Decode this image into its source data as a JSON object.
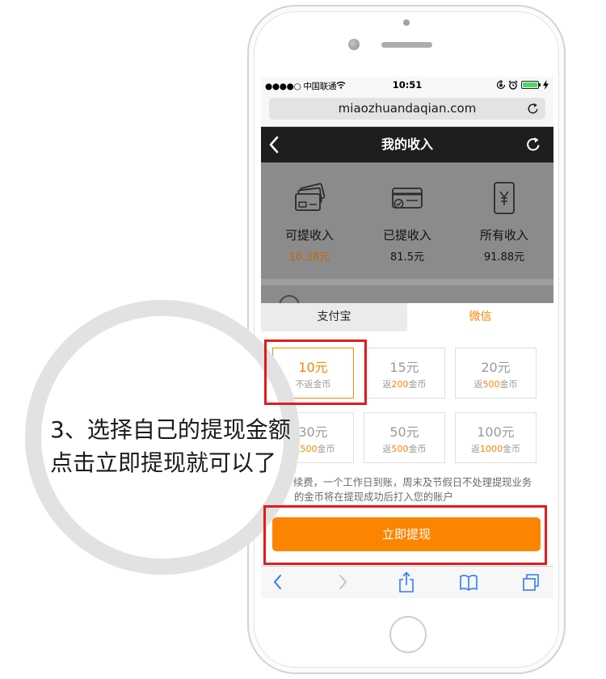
{
  "callout": {
    "line1": "3、选择自己的提现金额",
    "line2": "点击立即提现就可以了"
  },
  "status_bar": {
    "carrier": "●●●●○ 中国联通",
    "time": "10:51",
    "icons": [
      "wifi-icon",
      "orientation-lock-icon",
      "alarm-icon",
      "battery-icon",
      "charging-icon"
    ]
  },
  "browser": {
    "url": "miaozhuandaqian.com",
    "toolbar_icons": [
      "back-icon",
      "forward-icon",
      "share-icon",
      "bookmarks-icon",
      "tabs-icon"
    ]
  },
  "header": {
    "title": "我的收入",
    "icons": [
      "back-chevron-icon",
      "refresh-icon"
    ]
  },
  "income": [
    {
      "icon": "card-stack-icon",
      "label": "可提收入",
      "value": "10.38元"
    },
    {
      "icon": "card-check-icon",
      "label": "已提收入",
      "value": "81.5元"
    },
    {
      "icon": "phone-yuan-icon",
      "label": "所有收入",
      "value": "91.88元"
    }
  ],
  "withdraw": {
    "tabs": [
      {
        "label": "支付宝",
        "active": false
      },
      {
        "label": "微信",
        "active": true
      }
    ],
    "options": [
      {
        "amount": "10元",
        "note": "不返金币",
        "selected": true
      },
      {
        "amount": "15元",
        "prefix": "返",
        "coins": "200",
        "suffix": "金币",
        "selected": false
      },
      {
        "amount": "20元",
        "prefix": "返",
        "coins": "500",
        "suffix": "金币",
        "selected": false
      },
      {
        "amount": "30元",
        "prefix": "返",
        "coins": "500",
        "suffix": "金币",
        "selected": false
      },
      {
        "amount": "50元",
        "prefix": "返",
        "coins": "500",
        "suffix": "金币",
        "selected": false
      },
      {
        "amount": "100元",
        "prefix": "返",
        "coins": "1000",
        "suffix": "金币",
        "selected": false
      }
    ],
    "notes": [
      "续费，一个工作日到账，周末及节假日不处理提现业务",
      "的金币将在提现成功后打入您的账户"
    ],
    "submit_label": "立即提现"
  },
  "colors": {
    "accent": "#fb8500",
    "highlight": "#e31b1b",
    "toolbar_blue": "#2f7bf5",
    "header_bg": "#1e1e20"
  }
}
